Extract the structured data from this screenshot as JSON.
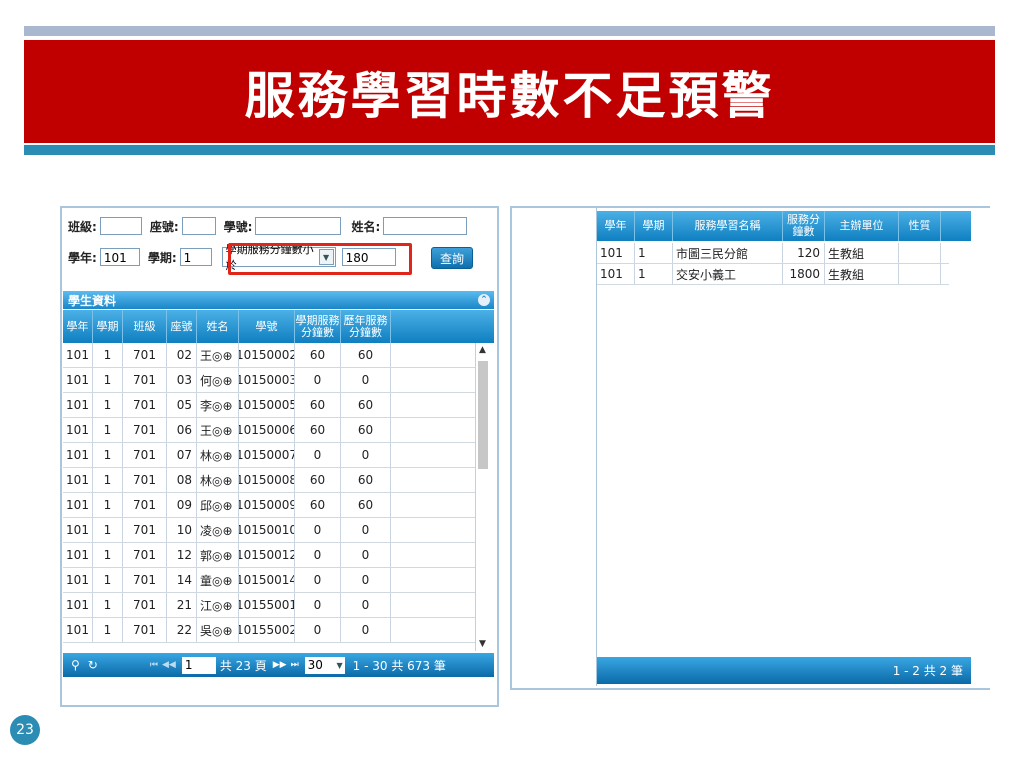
{
  "slide": {
    "title": "服務學習時數不足預警",
    "page_number": "23"
  },
  "form": {
    "class_label": "班級:",
    "class_value": "",
    "seat_label": "座號:",
    "seat_value": "",
    "student_no_label": "學號:",
    "student_no_value": "",
    "name_label": "姓名:",
    "name_value": "",
    "year_label": "學年:",
    "year_value": "101",
    "term_label": "學期:",
    "term_value": "1",
    "condition_select": "學期服務分鐘數小於",
    "condition_value": "180",
    "query_button": "查詢"
  },
  "student_grid": {
    "caption": "學生資料",
    "columns": [
      "學年",
      "學期",
      "班級",
      "座號",
      "姓名",
      "學號",
      "學期服務分鐘數",
      "歷年服務分鐘數"
    ],
    "rows": [
      [
        "101",
        "1",
        "701",
        "02",
        "王◎⊕",
        "10150002",
        "60",
        "60"
      ],
      [
        "101",
        "1",
        "701",
        "03",
        "何◎⊕",
        "10150003",
        "0",
        "0"
      ],
      [
        "101",
        "1",
        "701",
        "05",
        "李◎⊕",
        "10150005",
        "60",
        "60"
      ],
      [
        "101",
        "1",
        "701",
        "06",
        "王◎⊕",
        "10150006",
        "60",
        "60"
      ],
      [
        "101",
        "1",
        "701",
        "07",
        "林◎⊕",
        "10150007",
        "0",
        "0"
      ],
      [
        "101",
        "1",
        "701",
        "08",
        "林◎⊕",
        "10150008",
        "60",
        "60"
      ],
      [
        "101",
        "1",
        "701",
        "09",
        "邱◎⊕",
        "10150009",
        "60",
        "60"
      ],
      [
        "101",
        "1",
        "701",
        "10",
        "凌◎⊕",
        "10150010",
        "0",
        "0"
      ],
      [
        "101",
        "1",
        "701",
        "12",
        "郭◎⊕",
        "10150012",
        "0",
        "0"
      ],
      [
        "101",
        "1",
        "701",
        "14",
        "童◎⊕",
        "10150014",
        "0",
        "0"
      ],
      [
        "101",
        "1",
        "701",
        "21",
        "江◎⊕",
        "10155001",
        "0",
        "0"
      ],
      [
        "101",
        "1",
        "701",
        "22",
        "吳◎⊕",
        "10155002",
        "0",
        "0"
      ]
    ],
    "pager": {
      "page": "1",
      "total_pages_text": "共 23 頁",
      "page_size": "30",
      "range_text": "1 - 30 共 673 筆"
    }
  },
  "service_grid": {
    "columns": [
      "學年",
      "學期",
      "服務學習名稱",
      "服務分鐘數",
      "主辦單位",
      "性質"
    ],
    "rows": [
      [
        "101",
        "1",
        "市圖三民分館",
        "120",
        "生教組",
        ""
      ],
      [
        "101",
        "1",
        "交安小義工",
        "1800",
        "生教組",
        ""
      ]
    ],
    "pager": {
      "range_text": "1 - 2 共 2 筆"
    }
  },
  "colors": {
    "banner": "#c00000",
    "accent": "#2b8cb4",
    "grid_header": "#1a86c8"
  },
  "icons": {
    "search": "search-icon",
    "refresh": "refresh-icon",
    "first": "first-page-icon",
    "prev": "prev-page-icon",
    "next": "next-page-icon",
    "last": "last-page-icon",
    "collapse": "collapse-icon",
    "dropdown": "chevron-down-icon"
  }
}
